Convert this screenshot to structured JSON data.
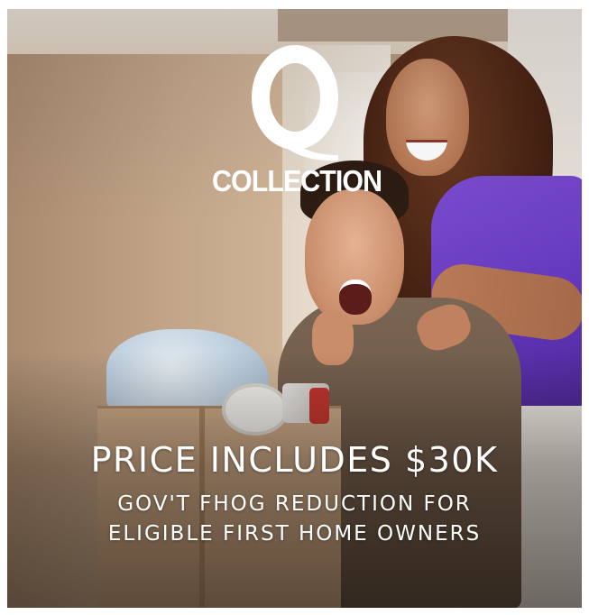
{
  "logo": {
    "mark": "Q",
    "wordmark": "COLLECTION",
    "icon": "q-collection-logo-icon"
  },
  "headline": "PRICE INCLUDES $30K",
  "subline": [
    "GOV'T FHOG REDUCTION FOR",
    "ELIGIBLE FIRST HOME OWNERS"
  ],
  "colors": {
    "text": "#ffffff",
    "shirt_woman": "#6a3ec4",
    "shirt_man": "#6e5a48",
    "box": "#c4a181"
  }
}
